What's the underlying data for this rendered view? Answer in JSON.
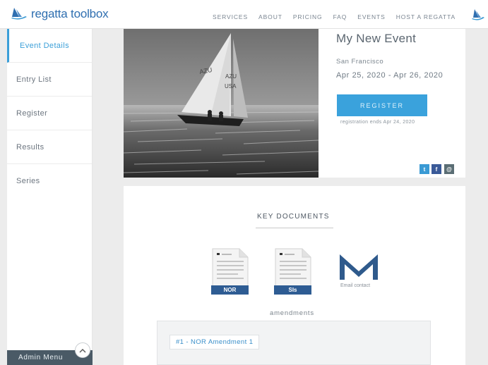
{
  "brand": {
    "logo_text": "regatta toolbox",
    "logo_icon": "sailboat-icon",
    "accent_color": "#3aa2dc",
    "logo_color": "#2f6fb0"
  },
  "nav": {
    "items": [
      "SERVICES",
      "ABOUT",
      "PRICING",
      "FAQ",
      "EVENTS",
      "HOST A REGATTA"
    ],
    "right_icon": "sailboat-icon"
  },
  "sidebar": {
    "items": [
      {
        "label": "Event Details",
        "active": true
      },
      {
        "label": "Entry List",
        "active": false
      },
      {
        "label": "Register",
        "active": false
      },
      {
        "label": "Results",
        "active": false
      },
      {
        "label": "Series",
        "active": false
      }
    ],
    "admin_label": "Admin Menu",
    "admin_toggle_icon": "chevron-up-icon"
  },
  "event": {
    "title": "My New Event",
    "location": "San Francisco",
    "dates": "Apr 25, 2020 - Apr 26, 2020",
    "register_label": "REGISTER",
    "registration_note": "registration ends Apr 24, 2020",
    "photo_icon": "sailboat-photo",
    "sail_numbers": [
      "AZU",
      "USA"
    ]
  },
  "social": {
    "twitter": "t",
    "facebook": "f",
    "email": "@"
  },
  "documents": {
    "heading": "KEY DOCUMENTS",
    "items": [
      {
        "label": "NOR",
        "icon": "document-icon"
      },
      {
        "label": "SIs",
        "icon": "document-icon"
      }
    ],
    "email_label": "Email contact",
    "email_icon": "email-icon"
  },
  "amendments": {
    "heading": "amendments",
    "items": [
      "#1 - NOR Amendment 1"
    ]
  }
}
